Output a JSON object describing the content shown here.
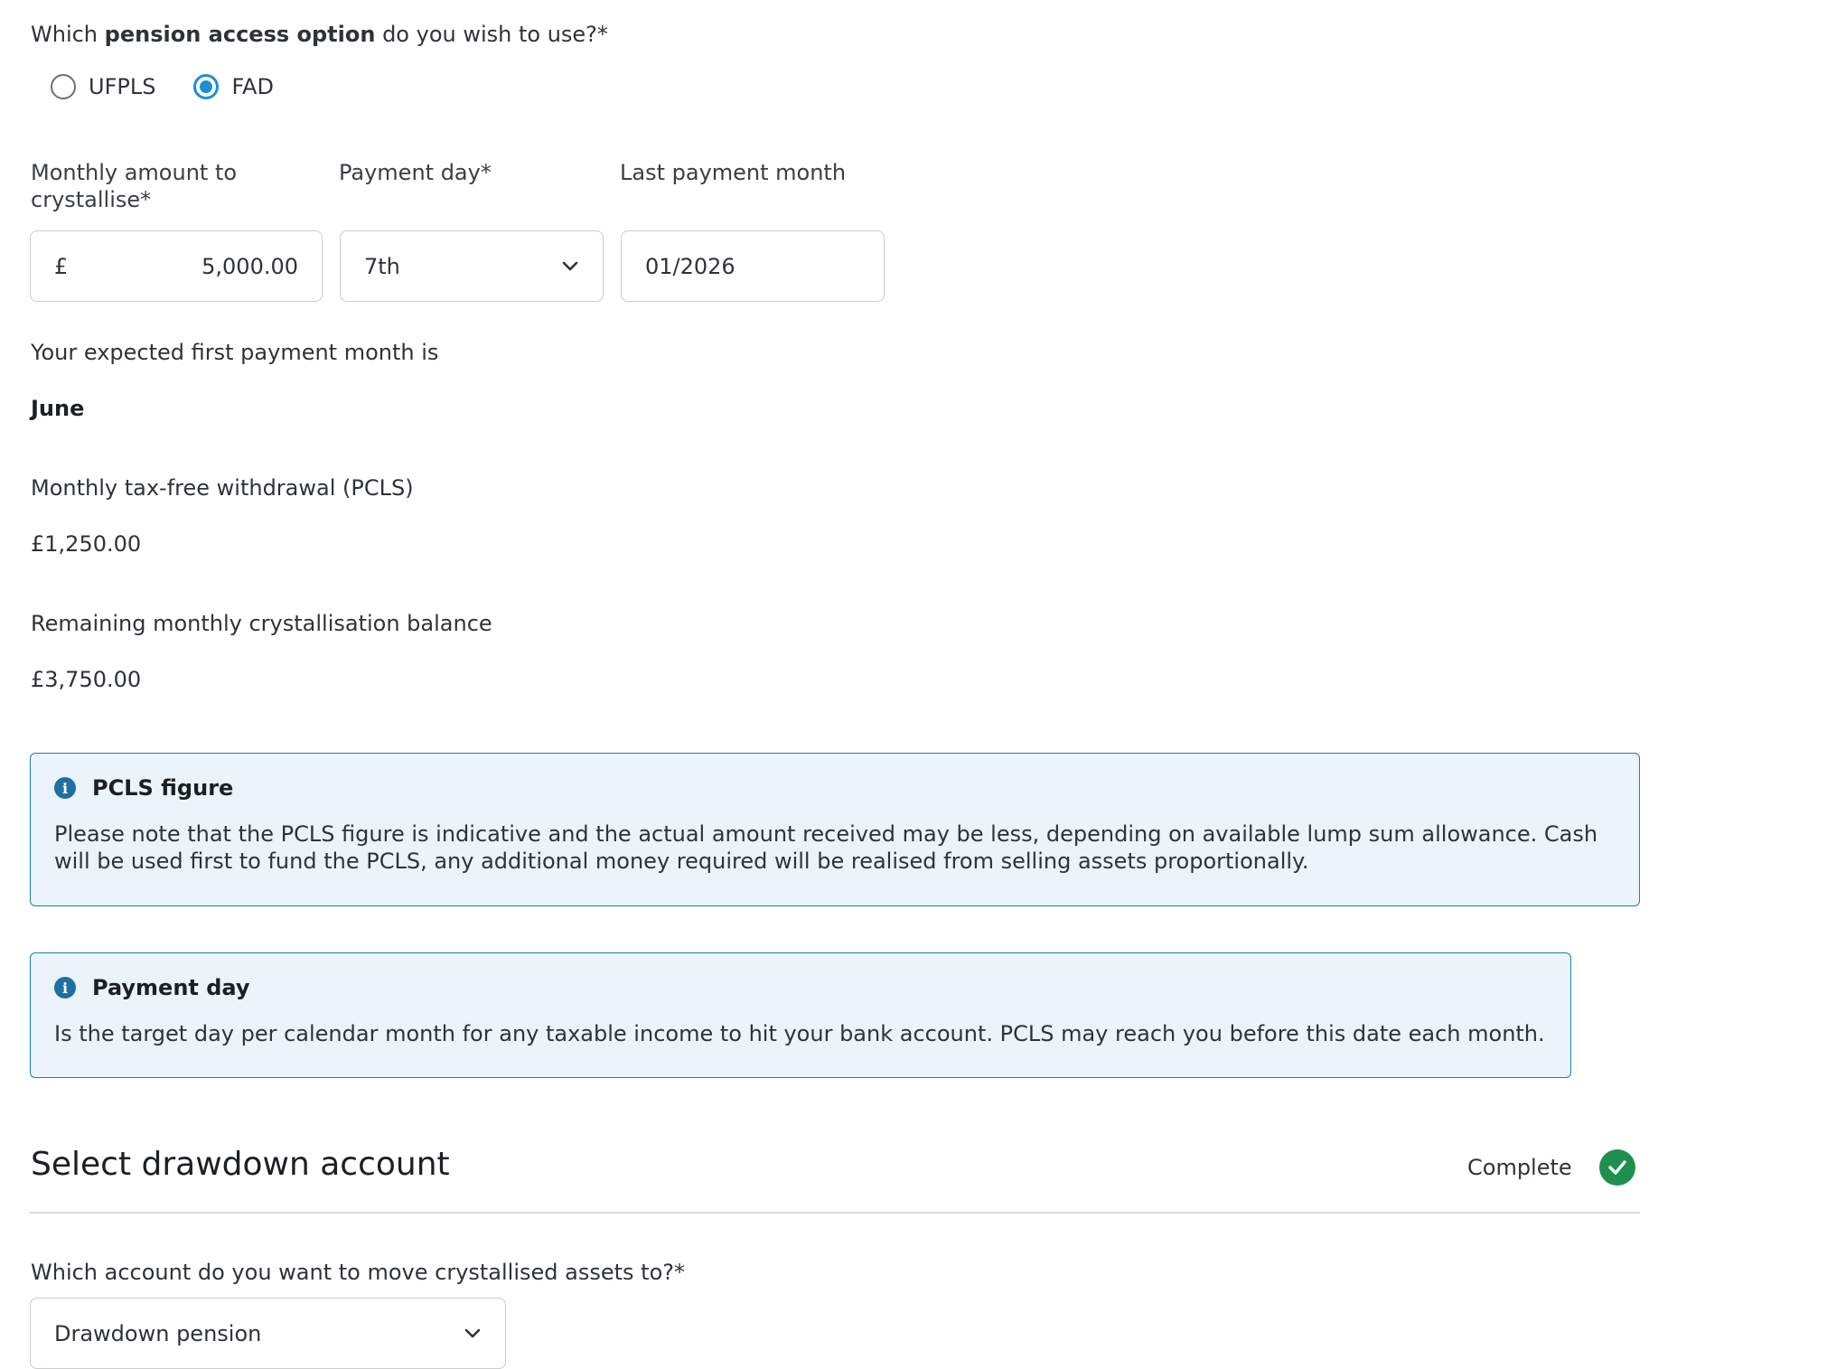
{
  "access_question": {
    "prefix": "Which ",
    "bold": "pension access option",
    "suffix": " do you wish to use?*",
    "options": [
      {
        "label": "UFPLS",
        "selected": false
      },
      {
        "label": "FAD",
        "selected": true
      }
    ]
  },
  "fields": {
    "monthly_amount_label_1": "Monthly amount to",
    "monthly_amount_label_2": "crystallise*",
    "currency_symbol": "£",
    "monthly_amount_value": "5,000.00",
    "payment_day_label": "Payment day*",
    "payment_day_value": "7th",
    "last_payment_label": "Last payment month",
    "last_payment_value": "01/2026"
  },
  "summary": {
    "first_payment_label": "Your expected first payment month is",
    "first_payment_value": "June",
    "pcls_label": "Monthly tax-free withdrawal (PCLS)",
    "pcls_value": "£1,250.00",
    "remaining_label": "Remaining monthly crystallisation balance",
    "remaining_value": "£3,750.00"
  },
  "callouts": {
    "pcls": {
      "title": "PCLS figure",
      "line1": "Please note that the PCLS figure is indicative and the actual amount received may be less, depending on available lump sum allowance. Cash",
      "line2": "will be used first to fund the PCLS, any additional money required will be realised from selling assets proportionally."
    },
    "payment_day": {
      "title": "Payment day",
      "body": "Is the target day per calendar month for any taxable income to hit your bank account. PCLS may reach you before this date each month."
    }
  },
  "drawdown_section": {
    "title": "Select drawdown account",
    "status": "Complete",
    "question": "Which account do you want to move crystallised assets to?*",
    "selected_account": "Drawdown pension"
  },
  "colors": {
    "accent_blue": "#1f8fd3",
    "callout_bg": "#eaf4fa",
    "callout_border": "#1f7fae",
    "success_green": "#1e8f4e"
  }
}
